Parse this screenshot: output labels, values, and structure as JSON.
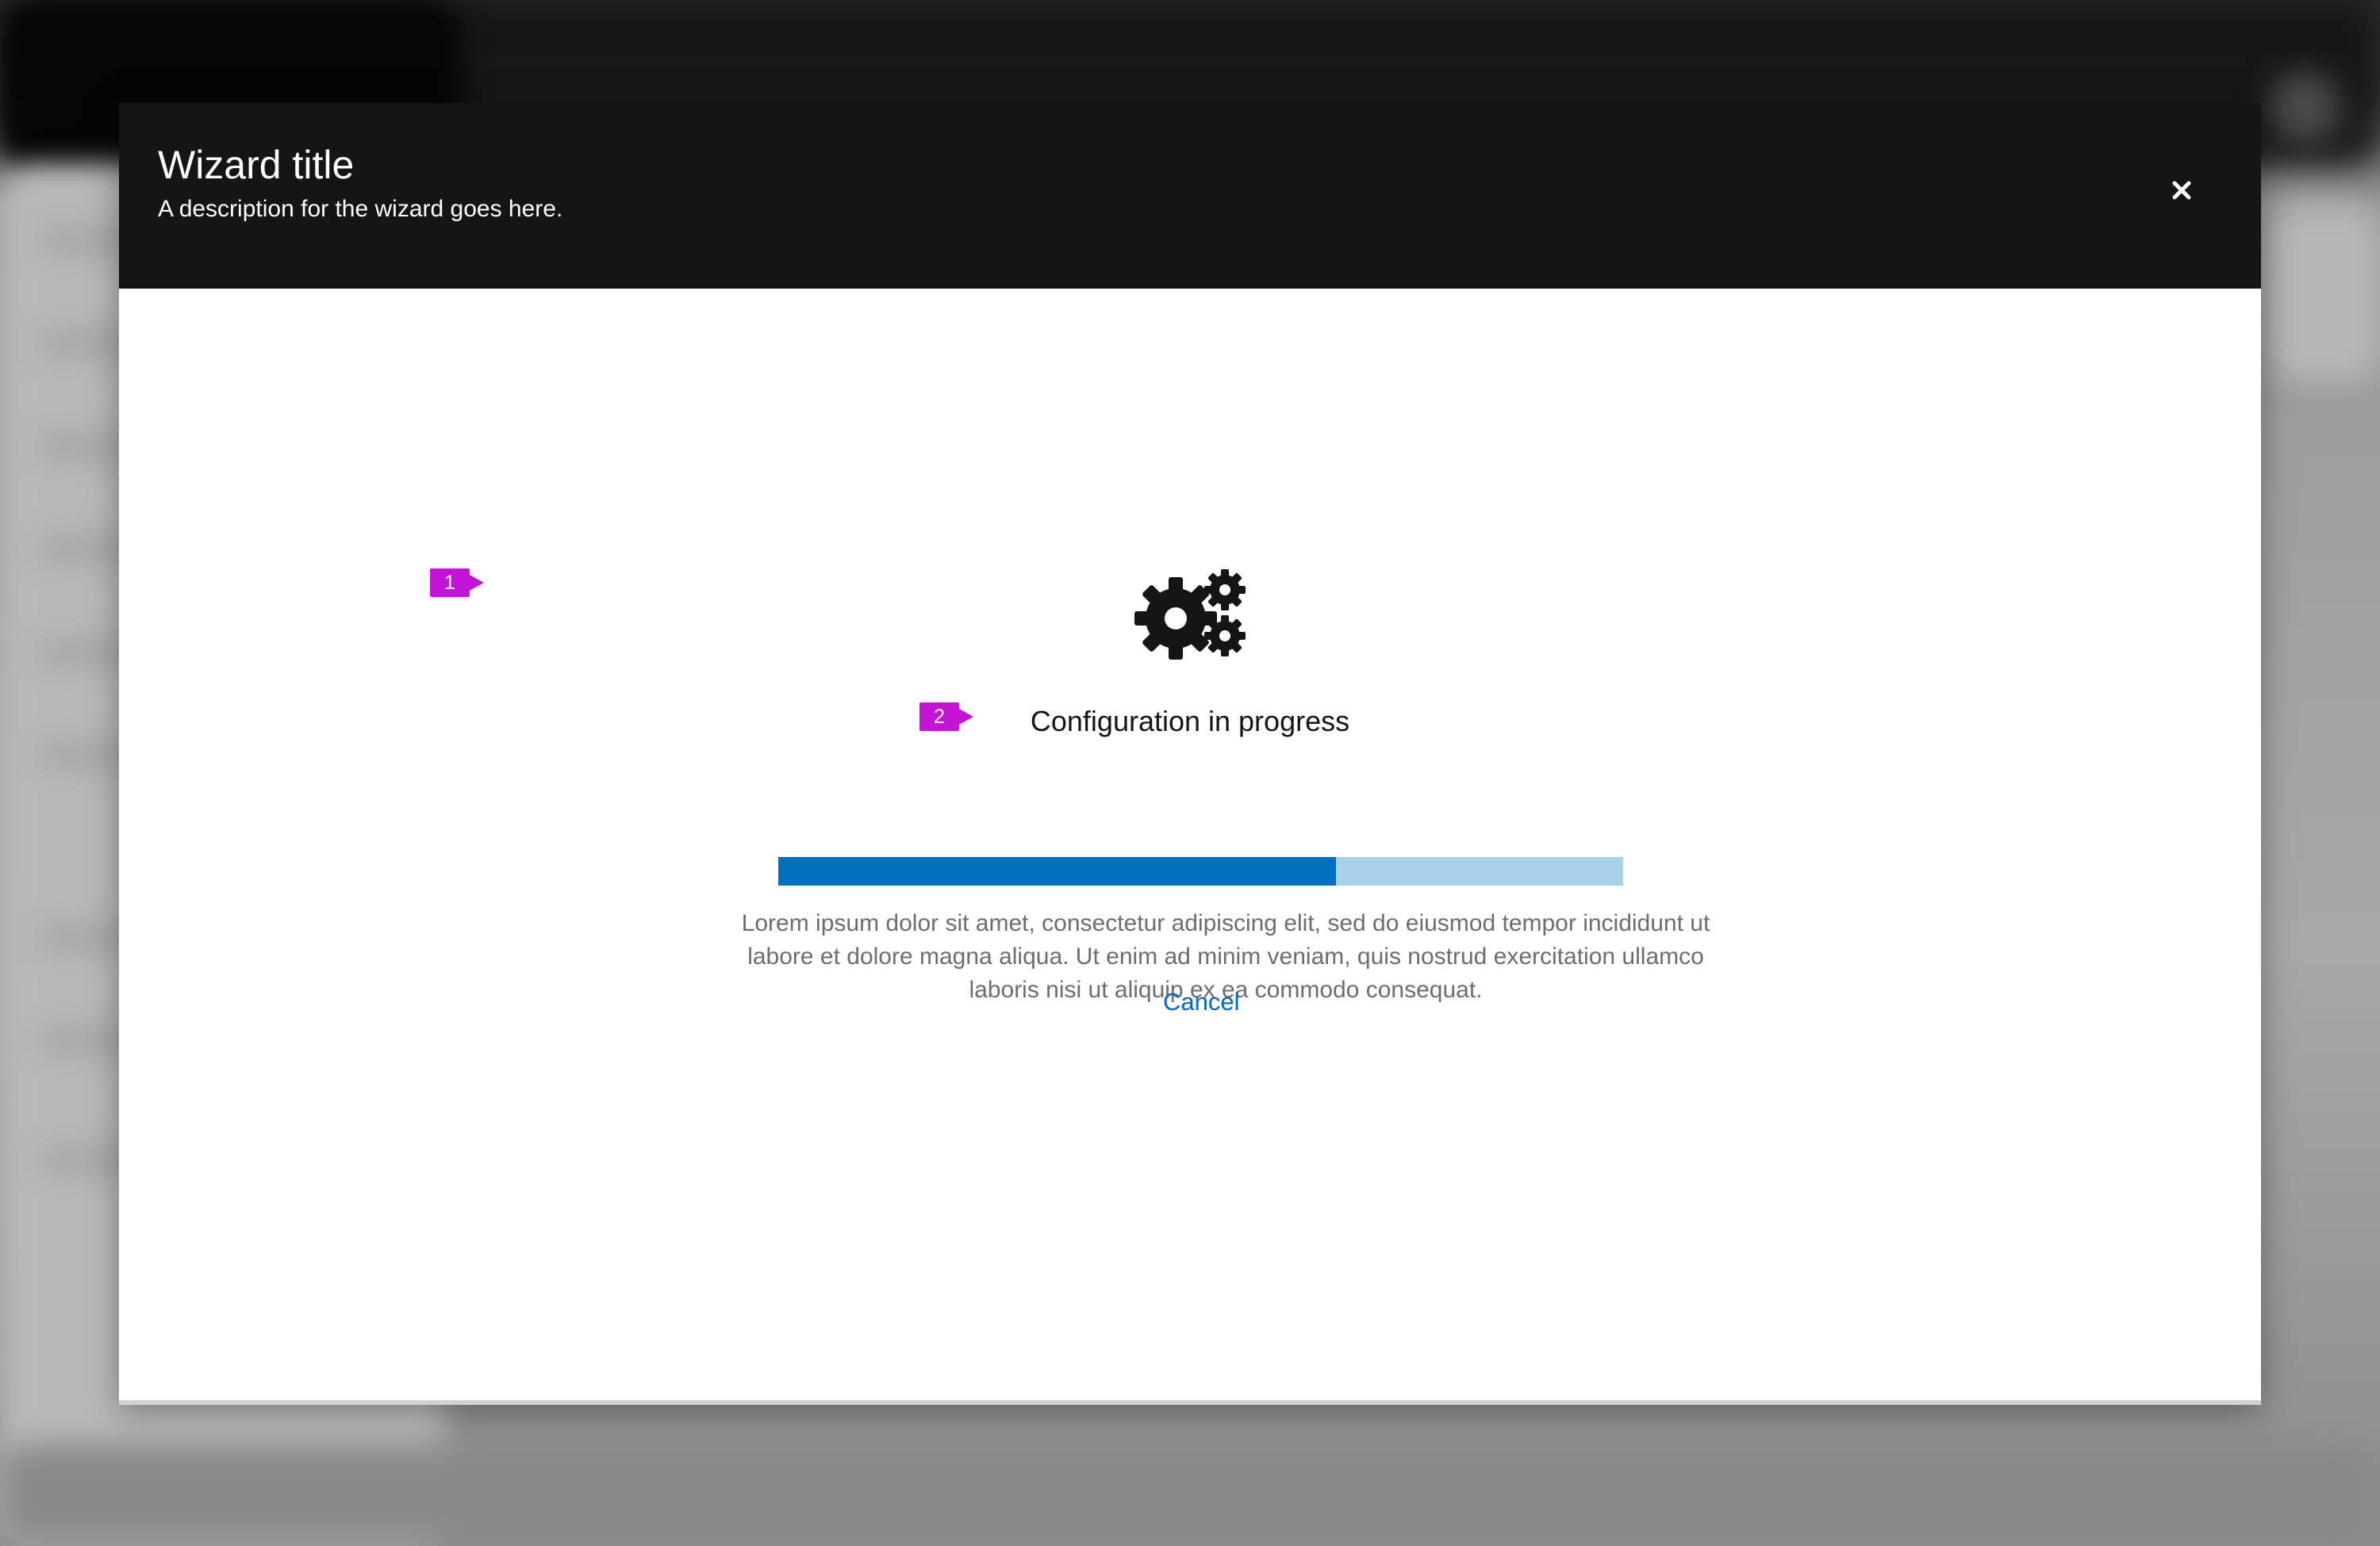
{
  "wizard": {
    "title": "Wizard title",
    "description": "A description for the wizard goes here.",
    "close_icon": "close-icon"
  },
  "status": {
    "icon": "cogs-icon",
    "title": "Configuration in progress",
    "progress_percent": 66,
    "body": "Lorem ipsum dolor sit amet, consectetur adipiscing elit, sed do eiusmod tempor incididunt ut labore et dolore magna aliqua. Ut enim ad minim veniam, quis nostrud exercitation ullamco laboris nisi ut aliquip ex ea commodo consequat.",
    "cancel_label": "Cancel"
  },
  "annotations": {
    "marker_1": "1",
    "marker_2": "2"
  },
  "colors": {
    "header_bg": "#151515",
    "progress_fill": "#0270bd",
    "progress_track": "#a6d1e8",
    "link": "#0066cc",
    "annotation": "#c415d6"
  }
}
